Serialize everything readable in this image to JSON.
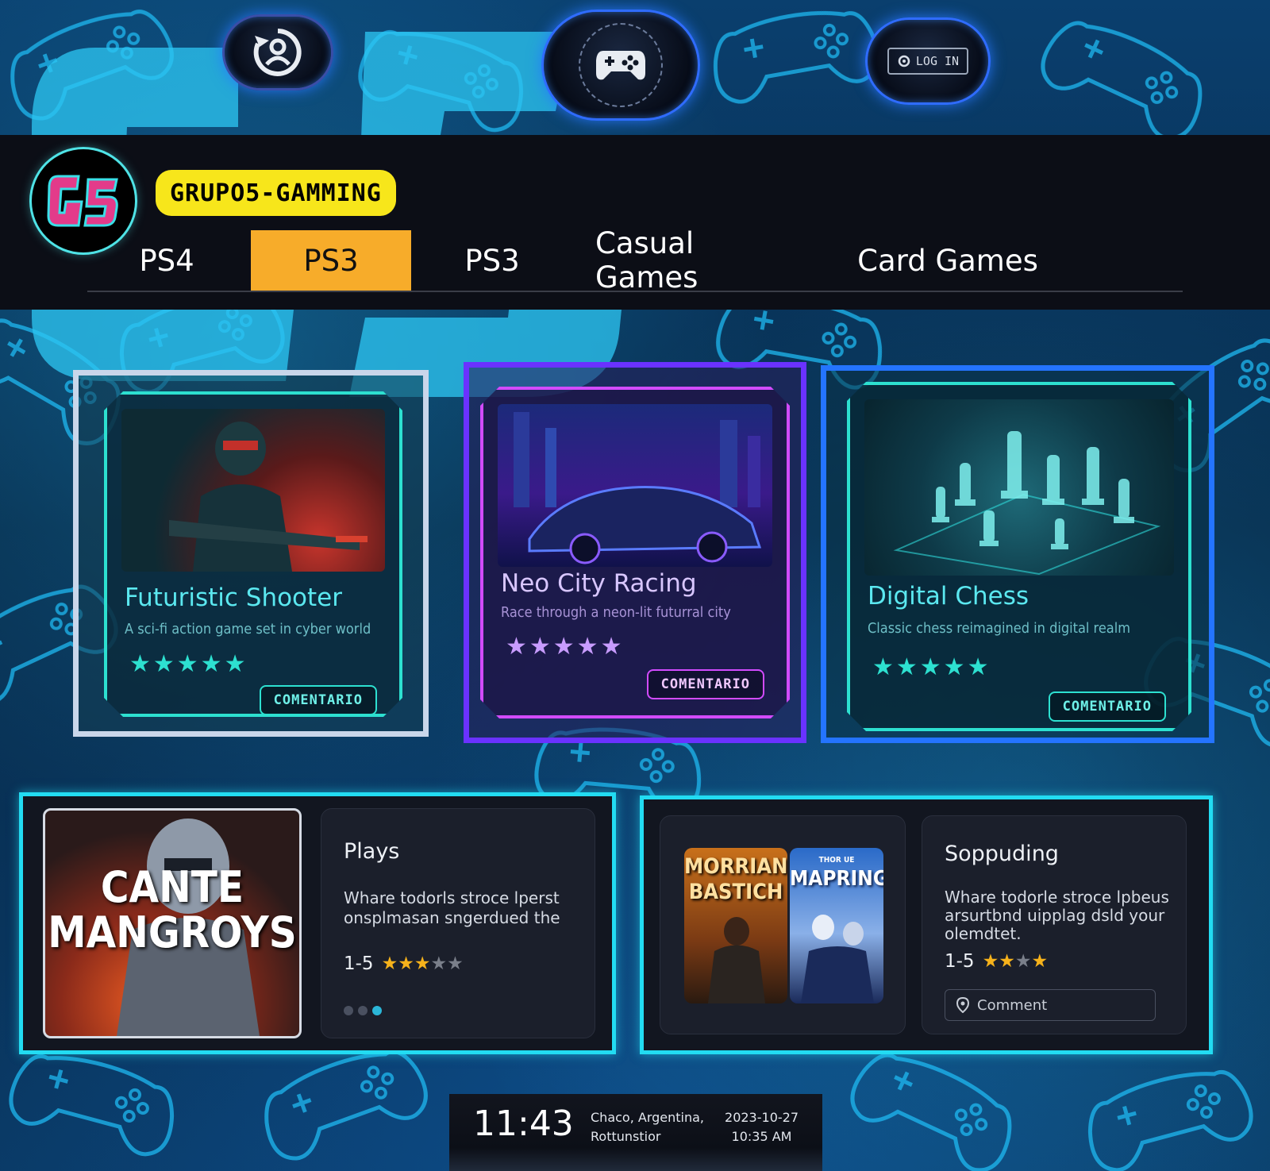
{
  "top_bar": {
    "user_button_icon": "user-refresh-icon",
    "game_button_icon": "gamepad-icon",
    "login_label": "LOG IN"
  },
  "header": {
    "logo_text": "G5",
    "brand": "GRUPO5-GAMMING",
    "tabs": [
      {
        "label": "PS4",
        "active": false
      },
      {
        "label": "PS3",
        "active": true
      },
      {
        "label": "PS3",
        "active": false
      },
      {
        "label": "Casual Games",
        "active": false
      },
      {
        "label": "Card Games",
        "active": false
      }
    ]
  },
  "cards": [
    {
      "title": "Futuristic Shooter",
      "subtitle": "A sci-fi action game set in cyber world",
      "rating": 4.5,
      "stars": "★★★★★",
      "button": "COMENTARIO",
      "accent": "#2de0d0"
    },
    {
      "title": "Neo City Racing",
      "subtitle": "Race through a neon-lit futurral city",
      "rating": 4.5,
      "stars": "★★★★★",
      "button": "COMENTARIO",
      "accent": "#d24bff"
    },
    {
      "title": "Digital Chess",
      "subtitle": "Classic chess reimagined in digital realm",
      "rating": 5,
      "stars": "★★★★★",
      "button": "COMENTARIO",
      "accent": "#2de0d0"
    }
  ],
  "panel_left": {
    "poster_title_line1": "CANTE",
    "poster_title_line2": "MANGROYS",
    "title": "Plays",
    "text_line1": "Whare todorls stroce lperst",
    "text_line2": "onsplmasan sngerdued the",
    "rating_label": "1-5",
    "rating": 3
  },
  "panel_right": {
    "poster1_line1": "MORRIANG",
    "poster1_line2": "BASTICH",
    "poster2_small": "THOR UE",
    "poster2_title": "MAPRING",
    "title": "Soppuding",
    "text_line1": "Whare todorle stroce lpbeus",
    "text_line2": "arsurtbnd uipplag dsld your",
    "text_line3": "olemdtet.",
    "rating_label": "1-5",
    "rating": 4,
    "comment_placeholder": "Comment"
  },
  "clock": {
    "time": "11:43",
    "location_line1": "Chaco, Argentina,",
    "location_line2": "Rottunstior",
    "date": "2023-10-27",
    "date_time": "10:35 AM"
  }
}
